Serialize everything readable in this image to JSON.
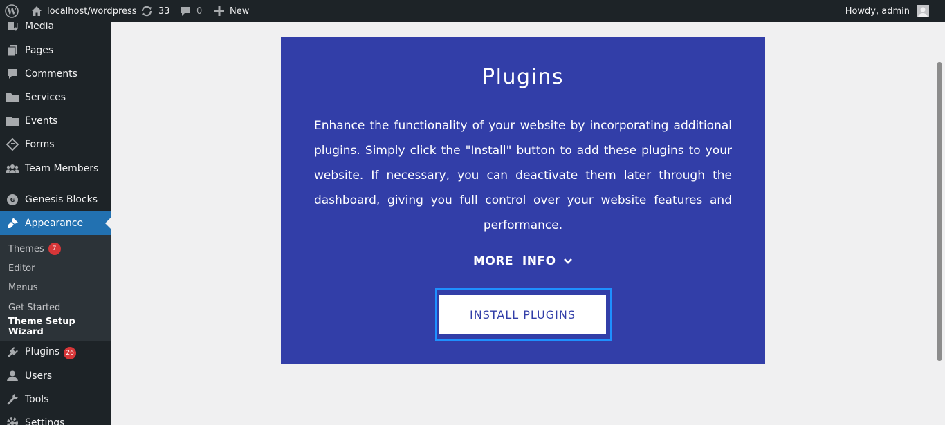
{
  "adminbar": {
    "wp_logo_icon": "wordpress-logo-icon",
    "site_name": "localhost/wordpress",
    "updates_count": "33",
    "comments_count": "0",
    "new_label": "New",
    "howdy": "Howdy, admin"
  },
  "sidebar": {
    "items": [
      {
        "label": "Media",
        "icon": "media-icon"
      },
      {
        "label": "Pages",
        "icon": "pages-icon"
      },
      {
        "label": "Comments",
        "icon": "comments-icon"
      },
      {
        "label": "Services",
        "icon": "folder-icon"
      },
      {
        "label": "Events",
        "icon": "folder-icon"
      },
      {
        "label": "Forms",
        "icon": "forms-icon"
      },
      {
        "label": "Team Members",
        "icon": "groups-icon"
      },
      {
        "label": "Genesis Blocks",
        "icon": "genesis-icon"
      },
      {
        "label": "Appearance",
        "icon": "brush-icon"
      },
      {
        "label": "Plugins",
        "icon": "plugins-icon",
        "badge": "26"
      },
      {
        "label": "Users",
        "icon": "users-icon"
      },
      {
        "label": "Tools",
        "icon": "tools-icon"
      },
      {
        "label": "Settings",
        "icon": "settings-icon"
      }
    ],
    "submenu": [
      {
        "label": "Themes",
        "badge": "7"
      },
      {
        "label": "Editor"
      },
      {
        "label": "Menus"
      },
      {
        "label": "Get Started"
      },
      {
        "label": "Theme Setup Wizard"
      }
    ]
  },
  "panel": {
    "title": "Plugins",
    "description": "Enhance the functionality of your website by incorporating additional plugins. Simply click the \"Install\" button to add these plugins to your website. If necessary, you can deactivate them later through the dashboard, giving you full control over your website features and performance.",
    "more_info": "MORE  INFO",
    "install_button": "INSTALL PLUGINS"
  },
  "colors": {
    "panel_bg": "#323ea8",
    "admin_bg": "#1d2327",
    "active_menu": "#2271b1",
    "focus_ring": "#1e90ff",
    "badge": "#d63638"
  }
}
